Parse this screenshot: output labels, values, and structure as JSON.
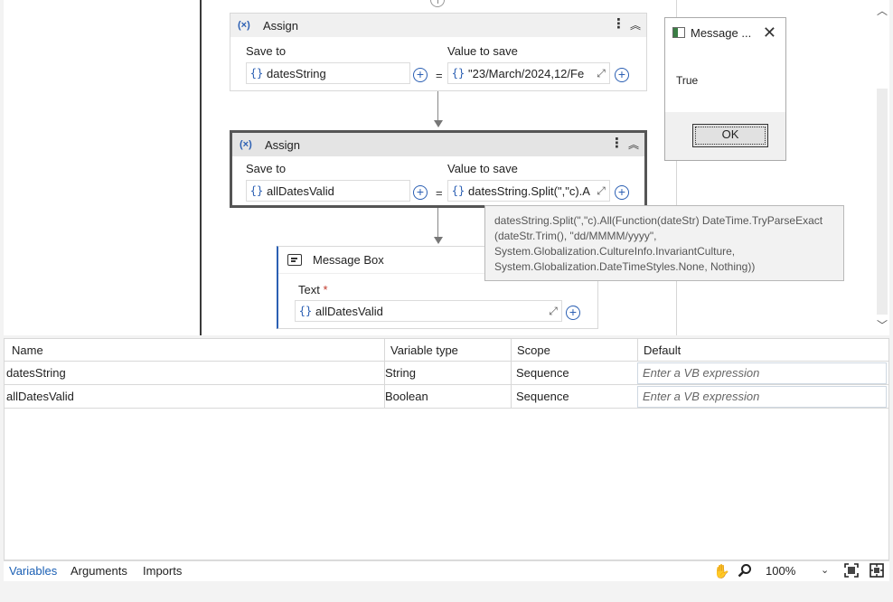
{
  "activities": {
    "assign1": {
      "title": "Assign",
      "save_to_label": "Save to",
      "save_to_value": "datesString",
      "value_label": "Value to save",
      "value": "\"23/March/2024,12/Fe"
    },
    "assign2": {
      "title": "Assign",
      "save_to_label": "Save to",
      "save_to_value": "allDatesValid",
      "value_label": "Value to save",
      "value": "datesString.Split(\",\"c).A"
    },
    "message_box": {
      "title": "Message Box",
      "text_label": "Text",
      "required_mark": "*",
      "text_value": "allDatesValid"
    }
  },
  "tooltip": {
    "lines": [
      "datesString.Split(\",\"c).All(Function(dateStr) DateTime.TryParseExact",
      "(dateStr.Trim(), \"dd/MMMM/yyyy\",",
      "System.Globalization.CultureInfo.InvariantCulture,",
      "System.Globalization.DateTimeStyles.None, Nothing))"
    ]
  },
  "dialog": {
    "title": "Message ...",
    "body": "True",
    "ok_label": "OK"
  },
  "variables": {
    "columns": [
      "Name",
      "Variable type",
      "Scope",
      "Default"
    ],
    "rows": [
      {
        "name": "datesString",
        "type": "String",
        "scope": "Sequence",
        "default_placeholder": "Enter a VB expression"
      },
      {
        "name": "allDatesValid",
        "type": "Boolean",
        "scope": "Sequence",
        "default_placeholder": "Enter a VB expression"
      }
    ]
  },
  "bottom": {
    "tabs": [
      "Variables",
      "Arguments",
      "Imports"
    ],
    "zoom": "100%"
  },
  "icons": {
    "assign": "assign-icon",
    "brace": "expression-icon",
    "plus": "plus-circle-icon",
    "expand": "expand-icon",
    "message": "message-box-icon",
    "hand": "hand-pan-icon",
    "search": "zoom-search-icon",
    "fit": "fit-screen-icon",
    "overview": "overview-icon"
  },
  "colors": {
    "accent": "#2b5fb3",
    "active_tab": "#1a5fb4"
  }
}
